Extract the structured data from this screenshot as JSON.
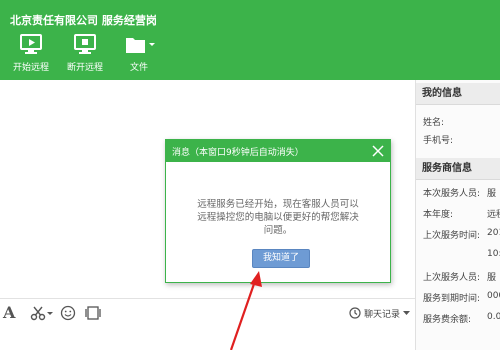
{
  "app": {
    "title": "北京责任有限公司 服务经营岗"
  },
  "toolbar": {
    "start_remote": {
      "label": "开始远程",
      "icon": "monitor-play-icon"
    },
    "stop_remote": {
      "label": "断开远程",
      "icon": "monitor-stop-icon"
    },
    "file": {
      "label": "文件",
      "icon": "folder-icon"
    }
  },
  "input_toolbar": {
    "font_glyph": "A",
    "history_label": "聊天记录"
  },
  "right_panel": {
    "my_info": {
      "title": "我的信息",
      "fields": [
        {
          "label": "姓名:",
          "value": ""
        },
        {
          "label": "手机号:",
          "value": ""
        }
      ]
    },
    "provider_info": {
      "title": "服务商信息",
      "fields": [
        {
          "label": "本次服务人员:",
          "value": "服"
        },
        {
          "label": "本年度:",
          "value": "远程"
        },
        {
          "label": "上次服务时间:",
          "value": "201"
        },
        {
          "label": "",
          "value": "10:"
        },
        {
          "label": "上次服务人员:",
          "value": "服"
        },
        {
          "label": "服务到期时间:",
          "value": "000"
        },
        {
          "label": "服务费余额:",
          "value": "0.0"
        }
      ]
    }
  },
  "dialog": {
    "title": "消息（本窗口9秒钟后自动消失）",
    "message": "远程服务已经开始，现在客服人员可以远程操控您的电脑以便更好的帮您解决问题。",
    "ok_label": "我知道了"
  },
  "colors": {
    "brand_green": "#3cb34a",
    "button_blue": "#6e9bd4",
    "arrow_red": "#e02020"
  }
}
